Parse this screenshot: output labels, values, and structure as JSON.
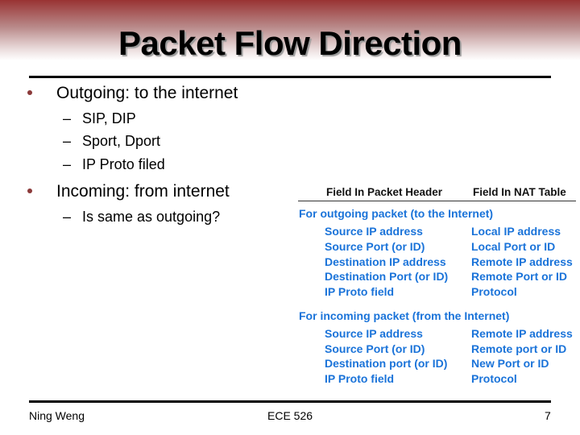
{
  "slide": {
    "title": "Packet Flow Direction",
    "accent_color": "#993333",
    "bullet_color": "#8b3a3a",
    "bullets": [
      {
        "text": "Outgoing: to the internet",
        "sub": [
          {
            "dash": "–",
            "text": "SIP, DIP"
          },
          {
            "dash": "–",
            "text": "Sport, Dport"
          },
          {
            "dash": "–",
            "text": "IP Proto filed"
          }
        ]
      },
      {
        "text": "Incoming: from internet",
        "sub": [
          {
            "dash": "–",
            "text": "Is same as outgoing?"
          }
        ]
      }
    ]
  },
  "table": {
    "text_color": "#1a73d9",
    "headers": [
      "Field In Packet Header",
      "Field In NAT Table"
    ],
    "sections": [
      {
        "label": "For outgoing packet (to the Internet)",
        "rows": [
          [
            "Source IP address",
            "Local IP address"
          ],
          [
            "Source Port (or ID)",
            "Local Port or ID"
          ],
          [
            "Destination IP address",
            "Remote IP address"
          ],
          [
            "Destination Port (or ID)",
            "Remote Port or ID"
          ],
          [
            "IP Proto field",
            "Protocol"
          ]
        ]
      },
      {
        "label": "For incoming packet (from the Internet)",
        "rows": [
          [
            "Source IP address",
            "Remote IP address"
          ],
          [
            "Source Port (or ID)",
            "Remote port or ID"
          ],
          [
            "Destination port (or ID)",
            "New Port or ID"
          ],
          [
            "IP Proto field",
            "Protocol"
          ]
        ]
      }
    ]
  },
  "footer": {
    "author": "Ning Weng",
    "course": "ECE 526",
    "page_number": "7"
  }
}
